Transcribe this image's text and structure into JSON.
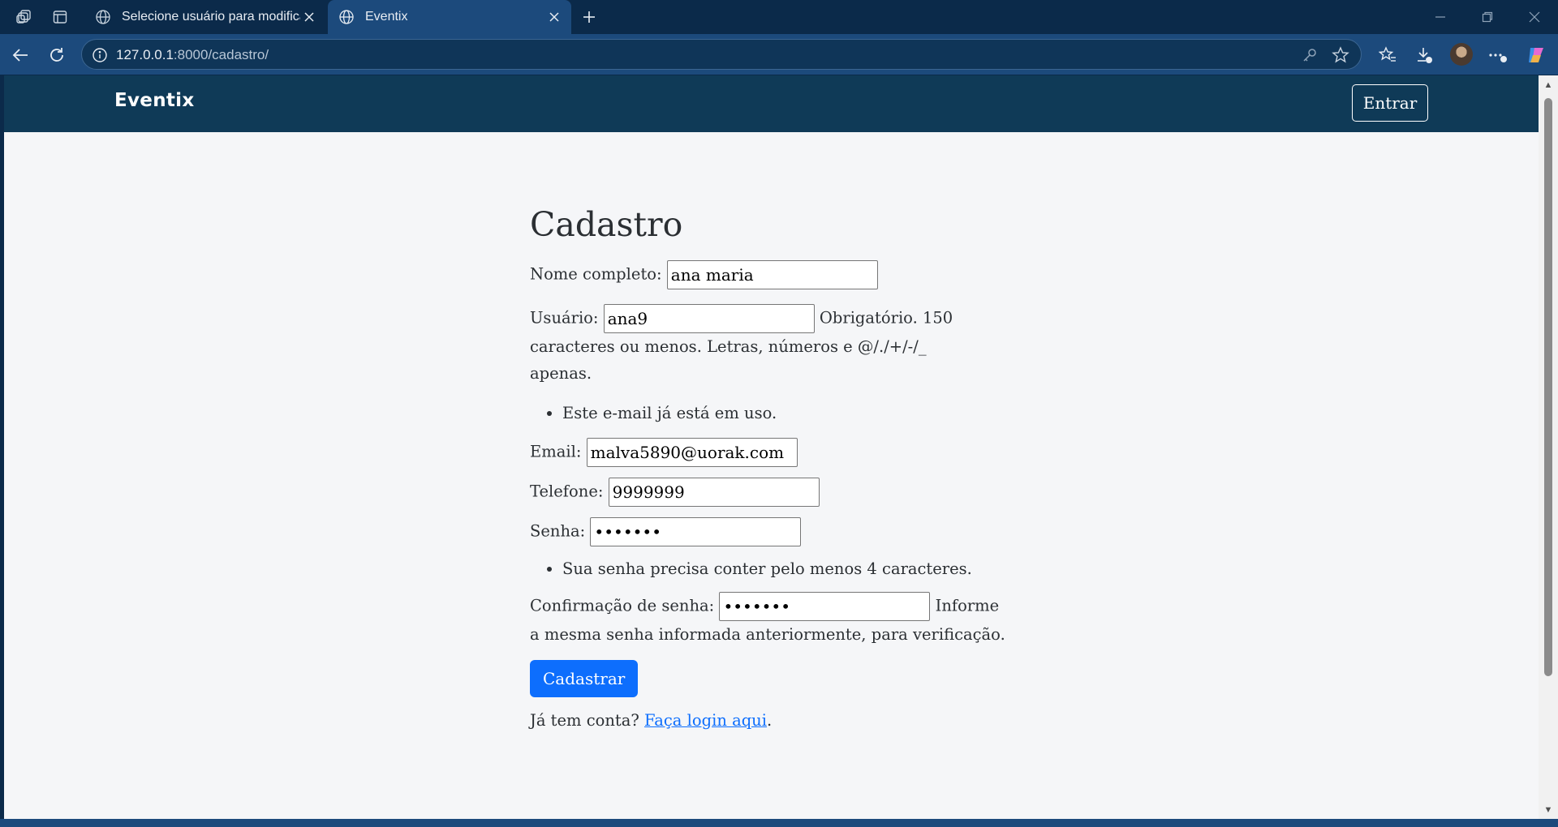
{
  "browser": {
    "tabs": [
      {
        "title": "Selecione usuário para modificar | "
      },
      {
        "title": "Eventix"
      }
    ],
    "url": {
      "host": "127.0.0.1",
      "rest": ":8000/cadastro/"
    }
  },
  "navbar": {
    "brand": "Eventix",
    "login_button": "Entrar"
  },
  "form": {
    "heading": "Cadastro",
    "nome": {
      "label": "Nome completo:",
      "value": "ana maria"
    },
    "usuario": {
      "label": "Usuário:",
      "value": "ana9",
      "help": "Obrigatório. 150 caracteres ou menos. Letras, números e @/./+/-/_ apenas."
    },
    "email_error": "Este e-mail já está em uso.",
    "email": {
      "label": "Email:",
      "value": "malva5890@uorak.com"
    },
    "telefone": {
      "label": "Telefone:",
      "value": "9999999"
    },
    "senha": {
      "label": "Senha:",
      "value": "•••••••"
    },
    "senha_error": "Sua senha precisa conter pelo menos 4 caracteres.",
    "confirmacao": {
      "label": "Confirmação de senha:",
      "value": "•••••••",
      "help": "Informe a mesma senha informada anteriormente, para verificação."
    },
    "submit": "Cadastrar",
    "footer_text": "Já tem conta?",
    "footer_link": "Faça login aqui",
    "footer_end": "."
  }
}
